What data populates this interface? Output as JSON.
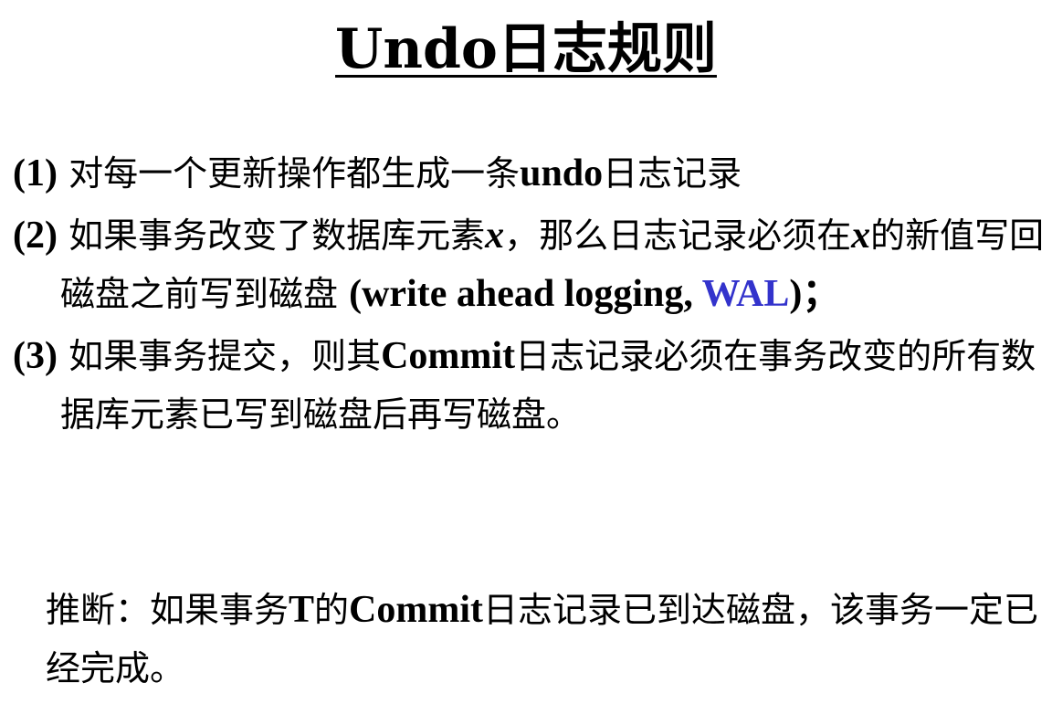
{
  "title": "Undo日志规则",
  "rules": [
    {
      "num": "(1)",
      "parts": {
        "a": "对每一个更新操作都生成一条",
        "b": "undo",
        "c": "日志记录"
      }
    },
    {
      "num": "(2)",
      "parts": {
        "a": "如果事务改变了数据库元素",
        "var1": "x",
        "b": "，那么日志记录必须在",
        "var2": "x",
        "c": "的新值写回磁盘之前写到磁盘",
        "d": "(write ahead logging, ",
        "highlight": "WAL",
        "e": ")；"
      }
    },
    {
      "num": "(3)",
      "parts": {
        "a": "如果事务提交，则其",
        "b": "Commit",
        "c": "日志记录必须在事务改变的所有数据库元素已写到磁盘后再写磁盘。"
      }
    }
  ],
  "inference": {
    "a": "推断：如果事务",
    "b": "T",
    "c": "的",
    "d": "Commit",
    "e": "日志记录已到达磁盘，该事务一定已经完成。"
  },
  "colors": {
    "text": "#000000",
    "highlight": "#3333cc",
    "background": "#ffffff"
  }
}
